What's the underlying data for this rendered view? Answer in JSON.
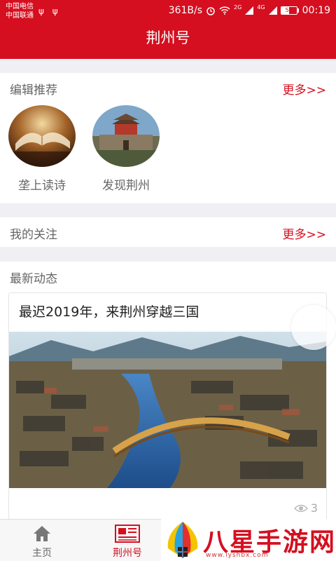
{
  "status": {
    "carrier1": "中国电信",
    "carrier2": "中国联通",
    "usb_icons": "ψ ψ",
    "speed": "361B/s",
    "signal1": "2G",
    "signal2": "4G",
    "battery": "50",
    "time": "00:19"
  },
  "header": {
    "title": "荆州号"
  },
  "recommend": {
    "title": "编辑推荐",
    "more": "更多>>",
    "items": [
      {
        "label": "垄上读诗",
        "icon": "book-photo"
      },
      {
        "label": "发现荆州",
        "icon": "city-gate-photo"
      }
    ]
  },
  "follow": {
    "title": "我的关注",
    "more": "更多>>"
  },
  "latest": {
    "title": "最新动态",
    "cards": [
      {
        "title": "最迟2019年，来荆州穿越三国",
        "views": "3",
        "image": "ancient-city-painting"
      }
    ]
  },
  "bottom_nav": {
    "items": [
      {
        "label": "主页",
        "icon": "home-icon",
        "active": false
      },
      {
        "label": "荆州号",
        "icon": "newspaper-icon",
        "active": true
      }
    ]
  },
  "watermark": {
    "text": "八星手游网",
    "url": "www.lyshbx.com"
  },
  "colors": {
    "accent": "#d50f1f",
    "background": "#efeff4"
  }
}
